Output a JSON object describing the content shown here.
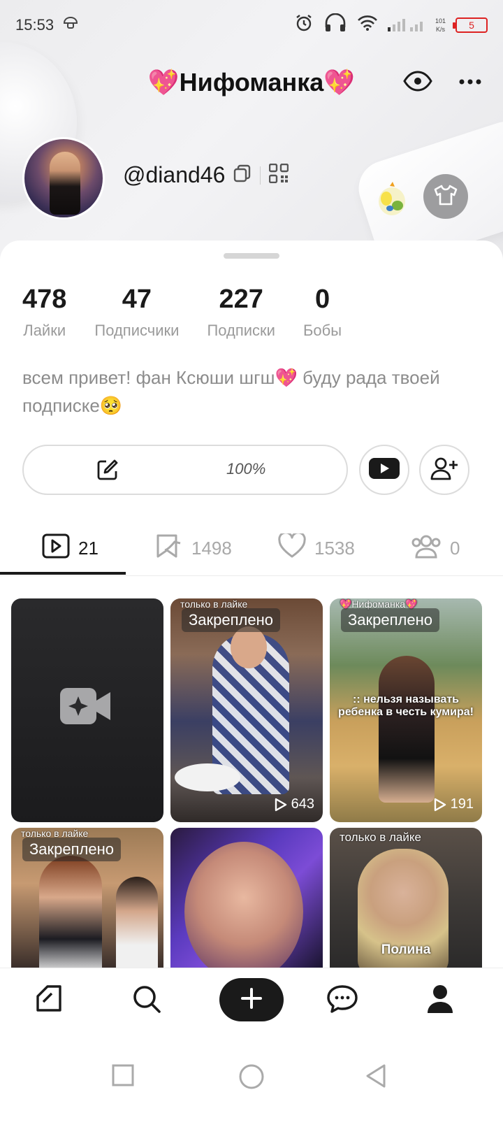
{
  "status_bar": {
    "time": "15:53",
    "net_speed_top": "101",
    "net_speed_bottom": "K/s",
    "battery": "5"
  },
  "header": {
    "title": "💖Нифоманка💖"
  },
  "profile": {
    "username": "@diand46"
  },
  "stats": [
    {
      "value": "478",
      "label": "Лайки"
    },
    {
      "value": "47",
      "label": "Подписчики"
    },
    {
      "value": "227",
      "label": "Подписки"
    },
    {
      "value": "0",
      "label": "Бобы"
    }
  ],
  "bio": "всем привет! фан Ксюши шгш💖 буду рада твоей подписке🥺",
  "actions": {
    "edit_percent": "100%"
  },
  "tabs": [
    {
      "icon": "video-icon",
      "count": "21"
    },
    {
      "icon": "bookmark-icon",
      "count": "1498"
    },
    {
      "icon": "heart-icon",
      "count": "1538"
    },
    {
      "icon": "group-icon",
      "count": "0"
    }
  ],
  "videos": [
    {
      "badge": "",
      "views": "",
      "top_text": "",
      "caption": ""
    },
    {
      "badge": "Закреплено",
      "views": "643",
      "top_text": "только в лайке",
      "caption": ""
    },
    {
      "badge": "Закреплено",
      "views": "191",
      "top_text": "💖Нифоманка💖",
      "caption": ":: нельзя называть ребенка в честь кумира!"
    },
    {
      "badge": "Закреплено",
      "views": "",
      "top_text": "только в лайке",
      "caption": ""
    },
    {
      "badge": "",
      "views": "",
      "top_text": "",
      "caption": ""
    },
    {
      "badge": "",
      "views": "",
      "top_text": "только в лайке",
      "caption": "Полина"
    }
  ],
  "bottom_nav": [
    "home-icon",
    "search-icon",
    "plus-icon",
    "messages-icon",
    "profile-icon"
  ]
}
